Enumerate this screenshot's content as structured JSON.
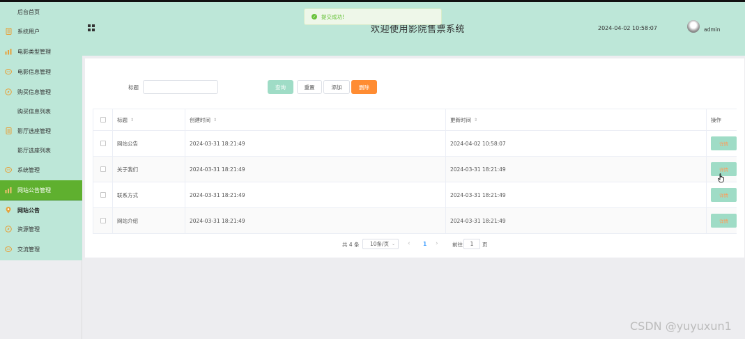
{
  "sidebar": {
    "items": [
      {
        "label": "后台首页",
        "icon": "none",
        "sub": true
      },
      {
        "label": "系统用户",
        "icon": "doc-icon"
      },
      {
        "label": "电影类型管理",
        "icon": "chart-icon"
      },
      {
        "label": "电影信息管理",
        "icon": "chat-icon"
      },
      {
        "label": "购买信息管理",
        "icon": "compass-icon"
      },
      {
        "label": "购买信息列表",
        "icon": "none",
        "sub": true
      },
      {
        "label": "影厅选座管理",
        "icon": "doc-icon"
      },
      {
        "label": "影厅选座列表",
        "icon": "none",
        "sub": true
      },
      {
        "label": "系统管理",
        "icon": "chat-icon"
      },
      {
        "label": "网站公告管理",
        "icon": "chart-icon",
        "active": true
      },
      {
        "label": "网站公告",
        "icon": "pin-icon",
        "bold": true
      },
      {
        "label": "资源管理",
        "icon": "compass-icon"
      },
      {
        "label": "交流管理",
        "icon": "chat-icon"
      }
    ]
  },
  "header": {
    "title": "欢迎使用影院售票系统",
    "datetime": "2024-04-02 10:58:07",
    "username": "admin"
  },
  "toast": {
    "message": "提交成功!"
  },
  "search": {
    "title_label": "标题",
    "title_value": ""
  },
  "buttons": {
    "query": "查询",
    "reset": "重置",
    "add": "添加",
    "delete": "删除"
  },
  "table": {
    "headers": {
      "title": "标题",
      "created": "创建时间",
      "updated": "更新时间",
      "actions": "操作"
    },
    "detail_label": "详情",
    "rows": [
      {
        "title": "网站公告",
        "created": "2024-03-31 18:21:49",
        "updated": "2024-04-02 10:58:07"
      },
      {
        "title": "关于我们",
        "created": "2024-03-31 18:21:49",
        "updated": "2024-03-31 18:21:49"
      },
      {
        "title": "联系方式",
        "created": "2024-03-31 18:21:49",
        "updated": "2024-03-31 18:21:49"
      },
      {
        "title": "网站介绍",
        "created": "2024-03-31 18:21:49",
        "updated": "2024-03-31 18:21:49"
      }
    ]
  },
  "pagination": {
    "total": "共 4 条",
    "page_size": "10条/页",
    "current_page": "1",
    "goto_label": "前往",
    "goto_value": "1",
    "page_unit": "页"
  },
  "watermark": "CSDN @yuyuxun1",
  "colors": {
    "header_bg": "#bde7d8",
    "active_item": "#5fb02f",
    "query_button": "#9fdcc6",
    "delete_button": "#ff8c32",
    "toast_text": "#67c23a"
  }
}
